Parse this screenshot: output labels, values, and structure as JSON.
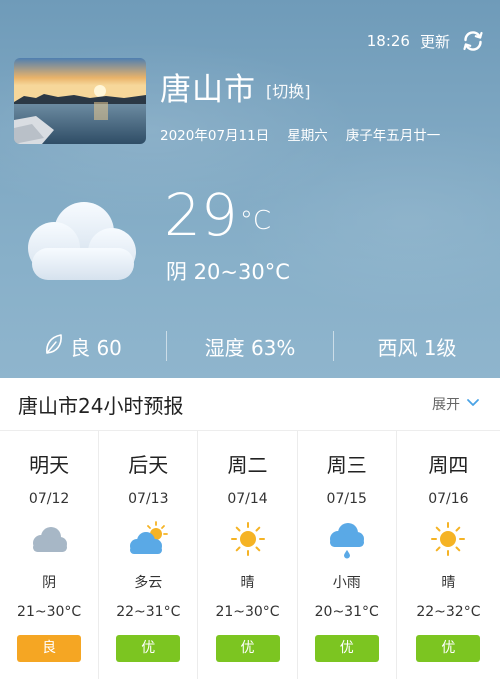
{
  "header": {
    "time": "18:26",
    "refresh_label": "更新",
    "city": "唐山市",
    "switch_label": "[切换]",
    "date": "2020年07月11日",
    "weekday": "星期六",
    "lunar": "庚子年五月廿一"
  },
  "current": {
    "temperature": "29",
    "unit": "°C",
    "summary": "阴 20~30°C",
    "icon": "cloudy-icon"
  },
  "stats": {
    "air": "良 60",
    "humidity": "湿度 63%",
    "wind": "西风 1级"
  },
  "forecast": {
    "title": "唐山市24小时预报",
    "expand_label": "展开",
    "days": [
      {
        "name": "明天",
        "date": "07/12",
        "condition": "阴",
        "range": "21~30°C",
        "aqi": "良",
        "aqi_color": "#f5a623",
        "icon": "cloudy-icon"
      },
      {
        "name": "后天",
        "date": "07/13",
        "condition": "多云",
        "range": "22~31°C",
        "aqi": "优",
        "aqi_color": "#7cc521",
        "icon": "partly-cloudy-icon"
      },
      {
        "name": "周二",
        "date": "07/14",
        "condition": "晴",
        "range": "21~30°C",
        "aqi": "优",
        "aqi_color": "#7cc521",
        "icon": "sun-icon"
      },
      {
        "name": "周三",
        "date": "07/15",
        "condition": "小雨",
        "range": "20~31°C",
        "aqi": "优",
        "aqi_color": "#7cc521",
        "icon": "light-rain-icon"
      },
      {
        "name": "周四",
        "date": "07/16",
        "condition": "晴",
        "range": "22~32°C",
        "aqi": "优",
        "aqi_color": "#7cc521",
        "icon": "sun-icon"
      }
    ]
  }
}
